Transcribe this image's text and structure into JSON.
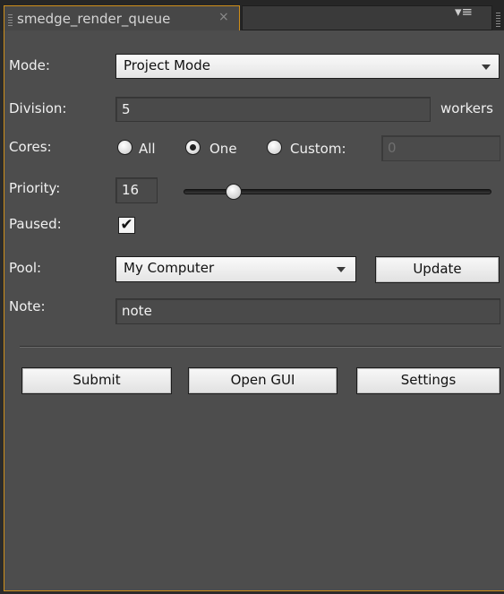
{
  "tab": {
    "title": "smedge_render_queue",
    "close_glyph": "×",
    "menu_glyph": "▾≡"
  },
  "form": {
    "mode": {
      "label": "Mode:",
      "value": "Project Mode"
    },
    "division": {
      "label": "Division:",
      "value": "5",
      "unit": "workers"
    },
    "cores": {
      "label": "Cores:",
      "options": [
        "All",
        "One",
        "Custom:"
      ],
      "selected": "One",
      "custom_value": "0"
    },
    "priority": {
      "label": "Priority:",
      "value": "16",
      "slider_fraction": 0.14
    },
    "paused": {
      "label": "Paused:",
      "checked": true,
      "check_glyph": "✔"
    },
    "pool": {
      "label": "Pool:",
      "value": "My Computer",
      "update_label": "Update"
    },
    "note": {
      "label": "Note:",
      "value": "note"
    }
  },
  "actions": {
    "submit_label": "Submit",
    "open_gui_label": "Open GUI",
    "settings_label": "Settings"
  },
  "colors": {
    "accent_border": "#cf8f1a",
    "panel_bg": "#4d4d4d",
    "frame_bg": "#2b2b2b"
  }
}
